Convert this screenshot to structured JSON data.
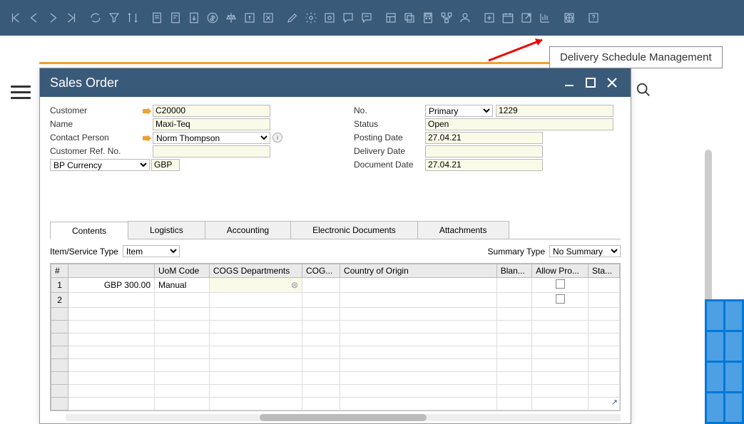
{
  "tooltip": "Delivery Schedule Management",
  "window": {
    "title": "Sales Order"
  },
  "header_left": {
    "customer_label": "Customer",
    "customer_value": "C20000",
    "name_label": "Name",
    "name_value": "Maxi-Teq",
    "contact_label": "Contact Person",
    "contact_value": "Norm Thompson",
    "ref_label": "Customer Ref. No.",
    "ref_value": "",
    "currency_label": "BP Currency",
    "currency_value": "GBP"
  },
  "header_right": {
    "no_label": "No.",
    "no_series": "Primary",
    "no_value": "1229",
    "status_label": "Status",
    "status_value": "Open",
    "posting_label": "Posting Date",
    "posting_value": "27.04.21",
    "delivery_label": "Delivery Date",
    "delivery_value": "",
    "docdate_label": "Document Date",
    "docdate_value": "27.04.21"
  },
  "tabs": {
    "contents": "Contents",
    "logistics": "Logistics",
    "accounting": "Accounting",
    "edocs": "Electronic Documents",
    "attachments": "Attachments"
  },
  "grid_ctrl": {
    "item_type_label": "Item/Service Type",
    "item_type_value": "Item",
    "summary_label": "Summary Type",
    "summary_value": "No Summary"
  },
  "grid": {
    "cols": {
      "num": "#",
      "blank": "",
      "uom": "UoM Code",
      "cogsdept": "COGS Departments",
      "cogs": "COG...",
      "origin": "Country of Origin",
      "blanket": "Blan...",
      "allow": "Allow Pro...",
      "status": "Sta..."
    },
    "rows": [
      {
        "num": "1",
        "price": "GBP 300.00",
        "uom": "Manual",
        "cogsdept": "",
        "cogs": "",
        "origin": "",
        "blanket": "",
        "allow_cb": true,
        "status": ""
      },
      {
        "num": "2",
        "price": "",
        "uom": "",
        "cogsdept": "",
        "cogs": "",
        "origin": "",
        "blanket": "",
        "allow_cb": true,
        "status": ""
      }
    ]
  }
}
